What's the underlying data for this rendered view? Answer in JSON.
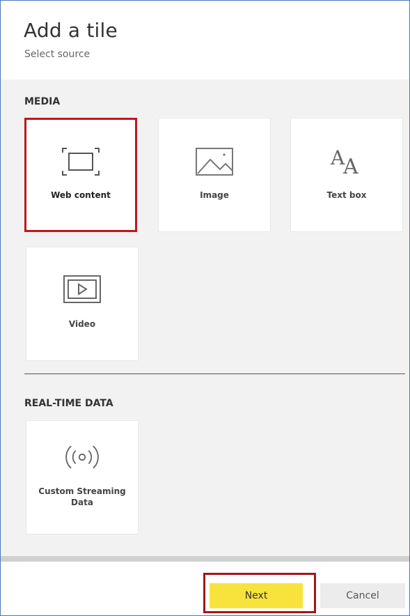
{
  "dialog": {
    "title": "Add a tile",
    "subtitle": "Select source"
  },
  "sections": {
    "media": {
      "label": "MEDIA",
      "tiles": [
        {
          "label": "Web content",
          "icon": "web-content-icon",
          "selected": true
        },
        {
          "label": "Image",
          "icon": "image-icon",
          "selected": false
        },
        {
          "label": "Text box",
          "icon": "text-box-icon",
          "selected": false
        },
        {
          "label": "Video",
          "icon": "video-icon",
          "selected": false
        }
      ]
    },
    "realtime": {
      "label": "REAL-TIME DATA",
      "tiles": [
        {
          "label_line1": "Custom Streaming",
          "label_line2": "Data",
          "icon": "streaming-icon",
          "selected": false
        }
      ]
    }
  },
  "footer": {
    "next_label": "Next",
    "cancel_label": "Cancel"
  },
  "colors": {
    "selection_border": "#c0161c",
    "next_button": "#f8e33c",
    "content_background": "#f2f2f2"
  }
}
